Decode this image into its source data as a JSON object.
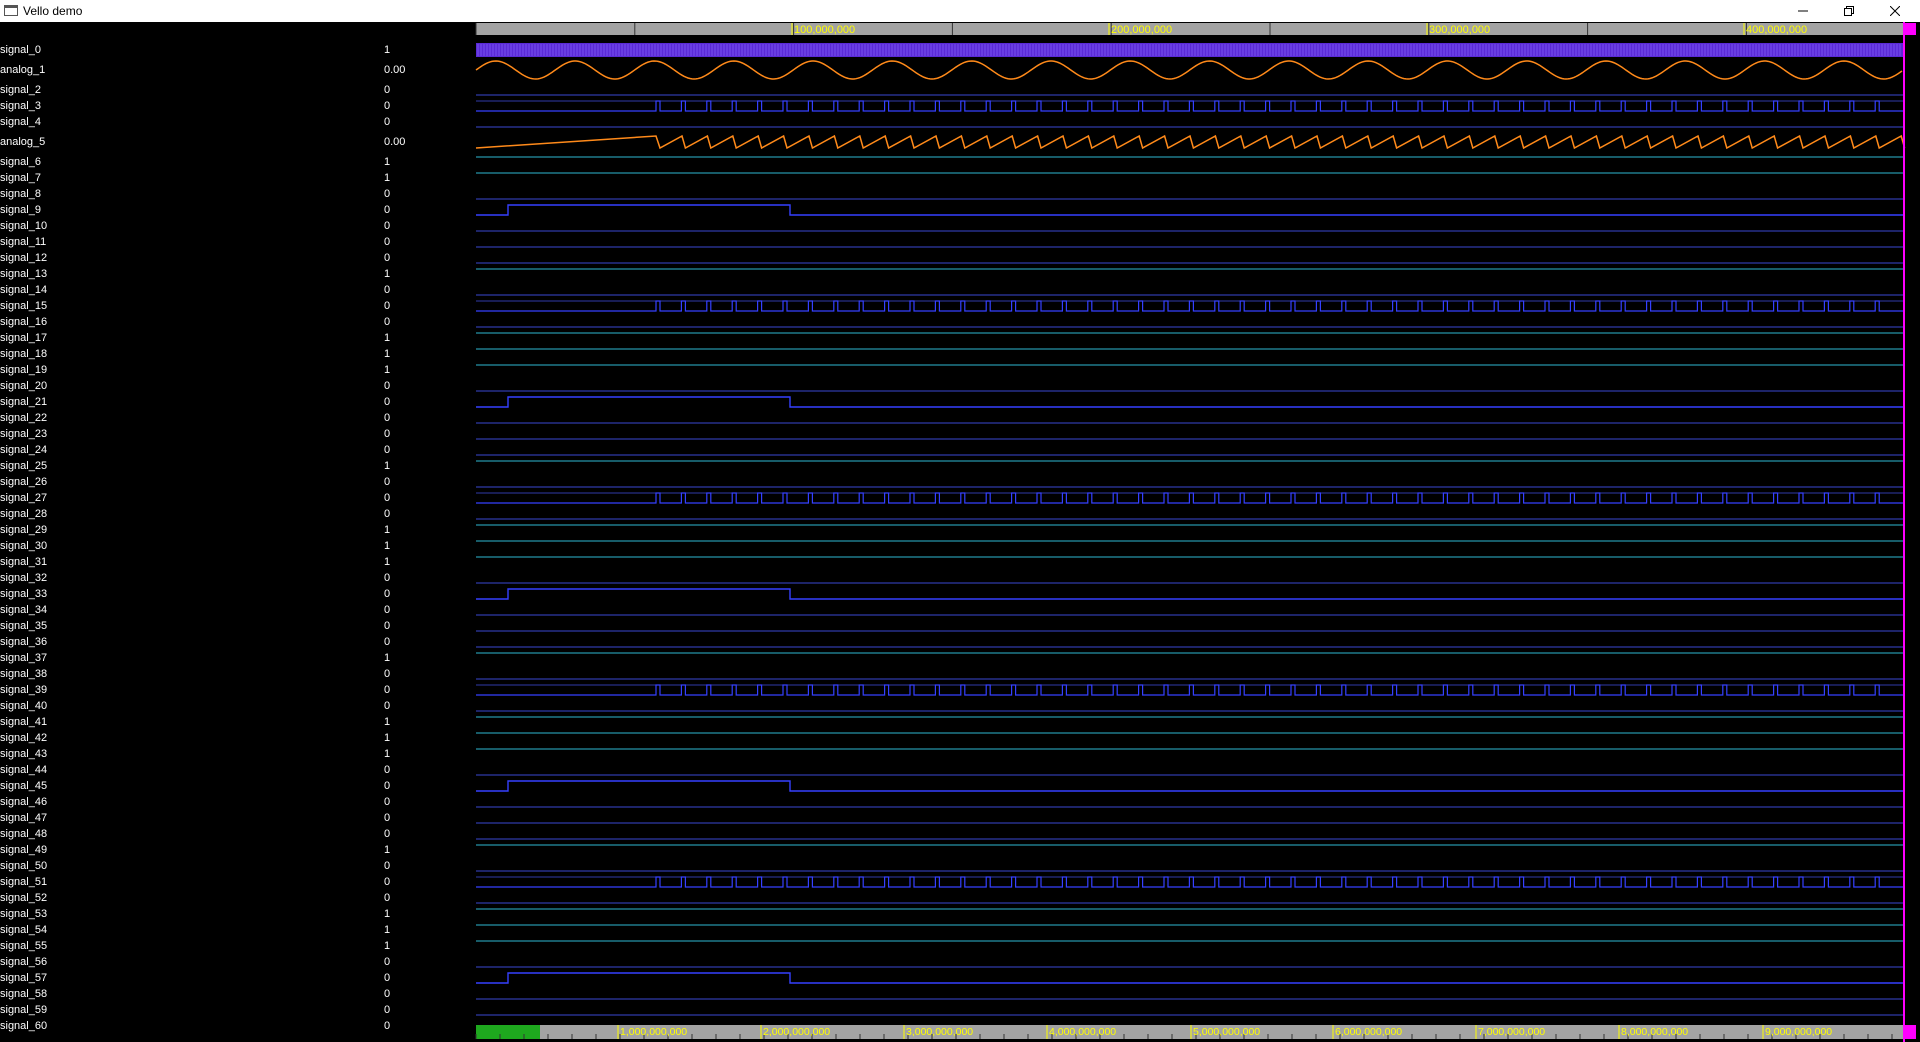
{
  "window": {
    "title": "Vello demo",
    "controls": {
      "minimize": "minimize-icon",
      "maximize": "restore-icon",
      "close": "close-icon"
    }
  },
  "colors": {
    "background": "#000000",
    "ruler": "#a3a3a3",
    "ruler_text": "#ffff00",
    "digital_high": "#3540ff",
    "digital_mid": "#2f3aa8",
    "digital_teal": "#1f7b8c",
    "analog": "#ff8a1a",
    "clock_bar": "#5a2ad6",
    "cursor": "#ff00ff",
    "overview_window": "#1ea81e"
  },
  "top_ruler": {
    "labels": [
      "100,000,000",
      "200,000,000",
      "300,000,000",
      "400,000,000"
    ]
  },
  "bottom_ruler": {
    "labels": [
      "1,000,000,000",
      "2,000,000,000",
      "3,000,000,000",
      "4,000,000,000",
      "5,000,000,000",
      "6,000,000,000",
      "7,000,000,000",
      "8,000,000,000",
      "9,000,000,000"
    ]
  },
  "signals": [
    {
      "name": "signal_0",
      "value": "1",
      "kind": "clock"
    },
    {
      "name": "analog_1",
      "value": "0.00",
      "kind": "analog_sine"
    },
    {
      "name": "signal_2",
      "value": "0",
      "kind": "low"
    },
    {
      "name": "signal_3",
      "value": "0",
      "kind": "pulses"
    },
    {
      "name": "signal_4",
      "value": "0",
      "kind": "low"
    },
    {
      "name": "analog_5",
      "value": "0.00",
      "kind": "analog_saw"
    },
    {
      "name": "signal_6",
      "value": "1",
      "kind": "high"
    },
    {
      "name": "signal_7",
      "value": "1",
      "kind": "high"
    },
    {
      "name": "signal_8",
      "value": "0",
      "kind": "low"
    },
    {
      "name": "signal_9",
      "value": "0",
      "kind": "step"
    },
    {
      "name": "signal_10",
      "value": "0",
      "kind": "low"
    },
    {
      "name": "signal_11",
      "value": "0",
      "kind": "low"
    },
    {
      "name": "signal_12",
      "value": "0",
      "kind": "low"
    },
    {
      "name": "signal_13",
      "value": "1",
      "kind": "high"
    },
    {
      "name": "signal_14",
      "value": "0",
      "kind": "low"
    },
    {
      "name": "signal_15",
      "value": "0",
      "kind": "pulses"
    },
    {
      "name": "signal_16",
      "value": "0",
      "kind": "low"
    },
    {
      "name": "signal_17",
      "value": "1",
      "kind": "high"
    },
    {
      "name": "signal_18",
      "value": "1",
      "kind": "high"
    },
    {
      "name": "signal_19",
      "value": "1",
      "kind": "high"
    },
    {
      "name": "signal_20",
      "value": "0",
      "kind": "low"
    },
    {
      "name": "signal_21",
      "value": "0",
      "kind": "step"
    },
    {
      "name": "signal_22",
      "value": "0",
      "kind": "low"
    },
    {
      "name": "signal_23",
      "value": "0",
      "kind": "low"
    },
    {
      "name": "signal_24",
      "value": "0",
      "kind": "low"
    },
    {
      "name": "signal_25",
      "value": "1",
      "kind": "high"
    },
    {
      "name": "signal_26",
      "value": "0",
      "kind": "low"
    },
    {
      "name": "signal_27",
      "value": "0",
      "kind": "pulses"
    },
    {
      "name": "signal_28",
      "value": "0",
      "kind": "low"
    },
    {
      "name": "signal_29",
      "value": "1",
      "kind": "high"
    },
    {
      "name": "signal_30",
      "value": "1",
      "kind": "high"
    },
    {
      "name": "signal_31",
      "value": "1",
      "kind": "high"
    },
    {
      "name": "signal_32",
      "value": "0",
      "kind": "low"
    },
    {
      "name": "signal_33",
      "value": "0",
      "kind": "step"
    },
    {
      "name": "signal_34",
      "value": "0",
      "kind": "low"
    },
    {
      "name": "signal_35",
      "value": "0",
      "kind": "low"
    },
    {
      "name": "signal_36",
      "value": "0",
      "kind": "low"
    },
    {
      "name": "signal_37",
      "value": "1",
      "kind": "high"
    },
    {
      "name": "signal_38",
      "value": "0",
      "kind": "low"
    },
    {
      "name": "signal_39",
      "value": "0",
      "kind": "pulses"
    },
    {
      "name": "signal_40",
      "value": "0",
      "kind": "low"
    },
    {
      "name": "signal_41",
      "value": "1",
      "kind": "high"
    },
    {
      "name": "signal_42",
      "value": "1",
      "kind": "high"
    },
    {
      "name": "signal_43",
      "value": "1",
      "kind": "high"
    },
    {
      "name": "signal_44",
      "value": "0",
      "kind": "low"
    },
    {
      "name": "signal_45",
      "value": "0",
      "kind": "step"
    },
    {
      "name": "signal_46",
      "value": "0",
      "kind": "low"
    },
    {
      "name": "signal_47",
      "value": "0",
      "kind": "low"
    },
    {
      "name": "signal_48",
      "value": "0",
      "kind": "low"
    },
    {
      "name": "signal_49",
      "value": "1",
      "kind": "high"
    },
    {
      "name": "signal_50",
      "value": "0",
      "kind": "low"
    },
    {
      "name": "signal_51",
      "value": "0",
      "kind": "pulses"
    },
    {
      "name": "signal_52",
      "value": "0",
      "kind": "low"
    },
    {
      "name": "signal_53",
      "value": "1",
      "kind": "high"
    },
    {
      "name": "signal_54",
      "value": "1",
      "kind": "high"
    },
    {
      "name": "signal_55",
      "value": "1",
      "kind": "high"
    },
    {
      "name": "signal_56",
      "value": "0",
      "kind": "low"
    },
    {
      "name": "signal_57",
      "value": "0",
      "kind": "step"
    },
    {
      "name": "signal_58",
      "value": "0",
      "kind": "low"
    },
    {
      "name": "signal_59",
      "value": "0",
      "kind": "low"
    },
    {
      "name": "signal_60",
      "value": "0",
      "kind": "low"
    }
  ]
}
